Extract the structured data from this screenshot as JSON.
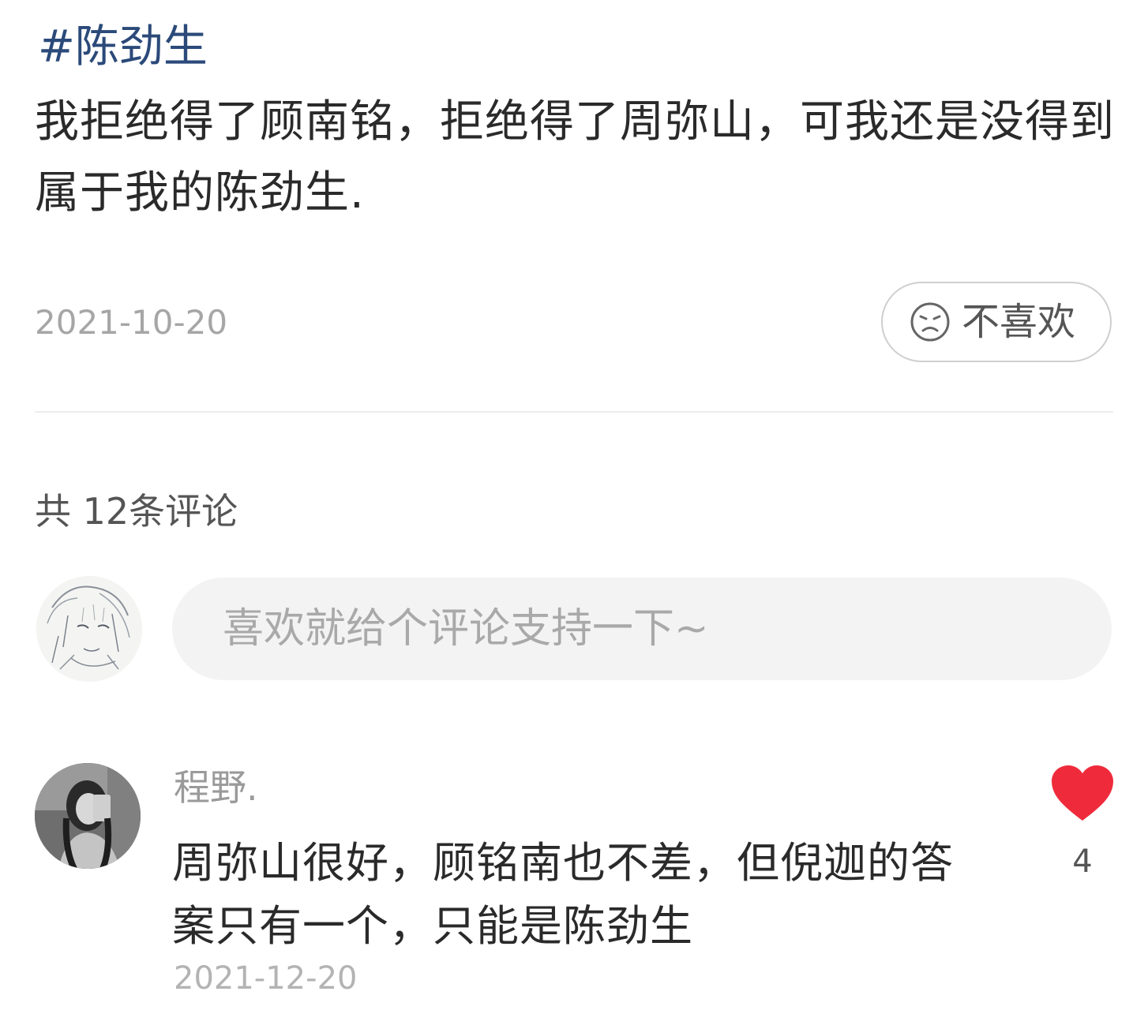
{
  "post": {
    "topic_tag": "#陈劲生",
    "text": "我拒绝得了顾南铭，拒绝得了周弥山，可我还是没得到属于我的陈劲生.",
    "date": "2021-10-20",
    "dislike_label": "不喜欢",
    "dislike_icon": "sad-face-icon"
  },
  "comments_section": {
    "count_label": "共 12条评论",
    "input_placeholder": "喜欢就给个评论支持一下~",
    "my_avatar": "user-avatar"
  },
  "comments": [
    {
      "author": "程野.",
      "text": "周弥山很好，顾铭南也不差，但倪迦的答案只有一个，只能是陈劲生",
      "date": "2021-12-20",
      "likes": "4",
      "like_icon": "heart-icon",
      "like_color": "#ef2b3b"
    }
  ],
  "colors": {
    "topic_tag": "#2b4a7a",
    "like_heart": "#ef2b3b"
  }
}
